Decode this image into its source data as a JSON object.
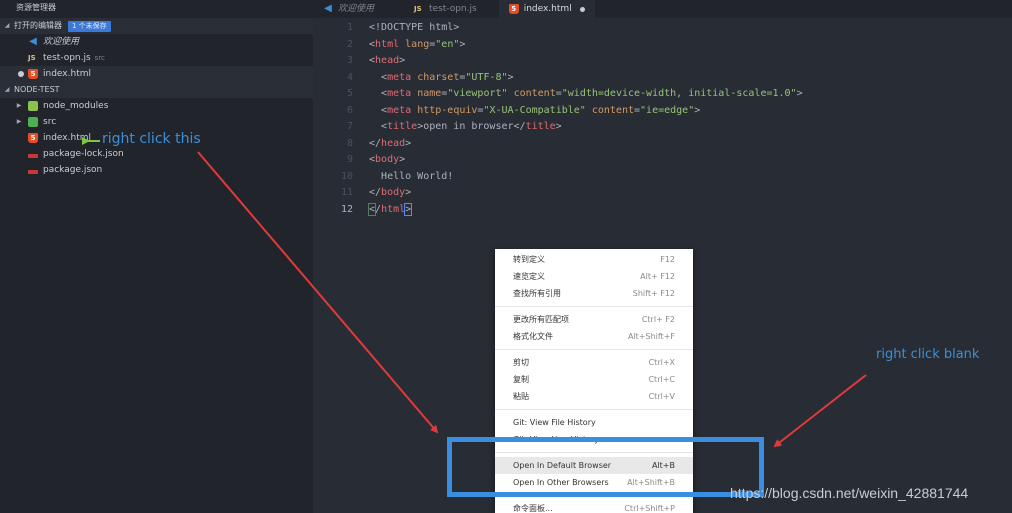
{
  "sidebar": {
    "title": "资源管理器",
    "open_editors": {
      "label": "打开的编辑器",
      "badge": "1 个未保存",
      "items": [
        {
          "name": "欢迎使用",
          "icon": "vscode-icon",
          "desc": ""
        },
        {
          "name": "test-opn.js",
          "icon": "js-icon",
          "desc": "src"
        },
        {
          "name": "index.html",
          "icon": "html5-icon",
          "desc": "",
          "modified": true
        }
      ]
    },
    "project": {
      "label": "NODE-TEST",
      "items": [
        {
          "name": "node_modules",
          "icon": "folder-node-icon",
          "type": "folder"
        },
        {
          "name": "src",
          "icon": "folder-src-icon",
          "type": "folder"
        },
        {
          "name": "index.html",
          "icon": "html5-icon",
          "type": "file"
        },
        {
          "name": "package-lock.json",
          "icon": "npm-icon",
          "type": "file"
        },
        {
          "name": "package.json",
          "icon": "npm-icon",
          "type": "file"
        }
      ]
    }
  },
  "tabs": [
    {
      "label": "欢迎使用",
      "icon": "vscode-icon",
      "active": false
    },
    {
      "label": "test-opn.js",
      "icon": "js-icon",
      "active": false
    },
    {
      "label": "index.html",
      "icon": "html5-icon",
      "active": true,
      "modified": true
    }
  ],
  "editor": {
    "current_line": 12,
    "lines": [
      {
        "n": "1",
        "text": "<!DOCTYPE html>"
      },
      {
        "n": "2",
        "text": "<html lang=\"en\">"
      },
      {
        "n": "3",
        "text": "<head>"
      },
      {
        "n": "4",
        "text": "  <meta charset=\"UTF-8\">"
      },
      {
        "n": "5",
        "text": "  <meta name=\"viewport\" content=\"width=device-width, initial-scale=1.0\">"
      },
      {
        "n": "6",
        "text": "  <meta http-equiv=\"X-UA-Compatible\" content=\"ie=edge\">"
      },
      {
        "n": "7",
        "text": "  <title>open in browser</title>"
      },
      {
        "n": "8",
        "text": "</head>"
      },
      {
        "n": "9",
        "text": "<body>"
      },
      {
        "n": "10",
        "text": "  Hello World!"
      },
      {
        "n": "11",
        "text": "</body>"
      },
      {
        "n": "12",
        "text": "</html>"
      }
    ]
  },
  "context_menu": {
    "groups": [
      [
        {
          "label": "转到定义",
          "shortcut": "F12"
        },
        {
          "label": "速览定义",
          "shortcut": "Alt+ F12"
        },
        {
          "label": "查找所有引用",
          "shortcut": "Shift+ F12"
        }
      ],
      [
        {
          "label": "更改所有匹配项",
          "shortcut": "Ctrl+ F2"
        },
        {
          "label": "格式化文件",
          "shortcut": "Alt+Shift+F"
        }
      ],
      [
        {
          "label": "剪切",
          "shortcut": "Ctrl+X"
        },
        {
          "label": "复制",
          "shortcut": "Ctrl+C"
        },
        {
          "label": "粘贴",
          "shortcut": "Ctrl+V"
        }
      ],
      [
        {
          "label": "Git: View File History",
          "shortcut": ""
        },
        {
          "label": "Git: View Line History",
          "shortcut": ""
        }
      ],
      [
        {
          "label": "Open In Default Browser",
          "shortcut": "Alt+B",
          "highlighted": true
        },
        {
          "label": "Open In Other Browsers",
          "shortcut": "Alt+Shift+B"
        }
      ],
      [
        {
          "label": "命令面板...",
          "shortcut": "Ctrl+Shift+P"
        }
      ]
    ]
  },
  "annotations": {
    "right_click_file": "right click this",
    "right_click_blank": "right click blank",
    "watermark": "https://blog.csdn.net/weixin_42881744"
  },
  "colors": {
    "annotation_blue": "#3d8fd8",
    "arrow_red": "#e03a3a",
    "arrow_green": "#7ac943",
    "highlight_box": "#3a8ee0"
  }
}
